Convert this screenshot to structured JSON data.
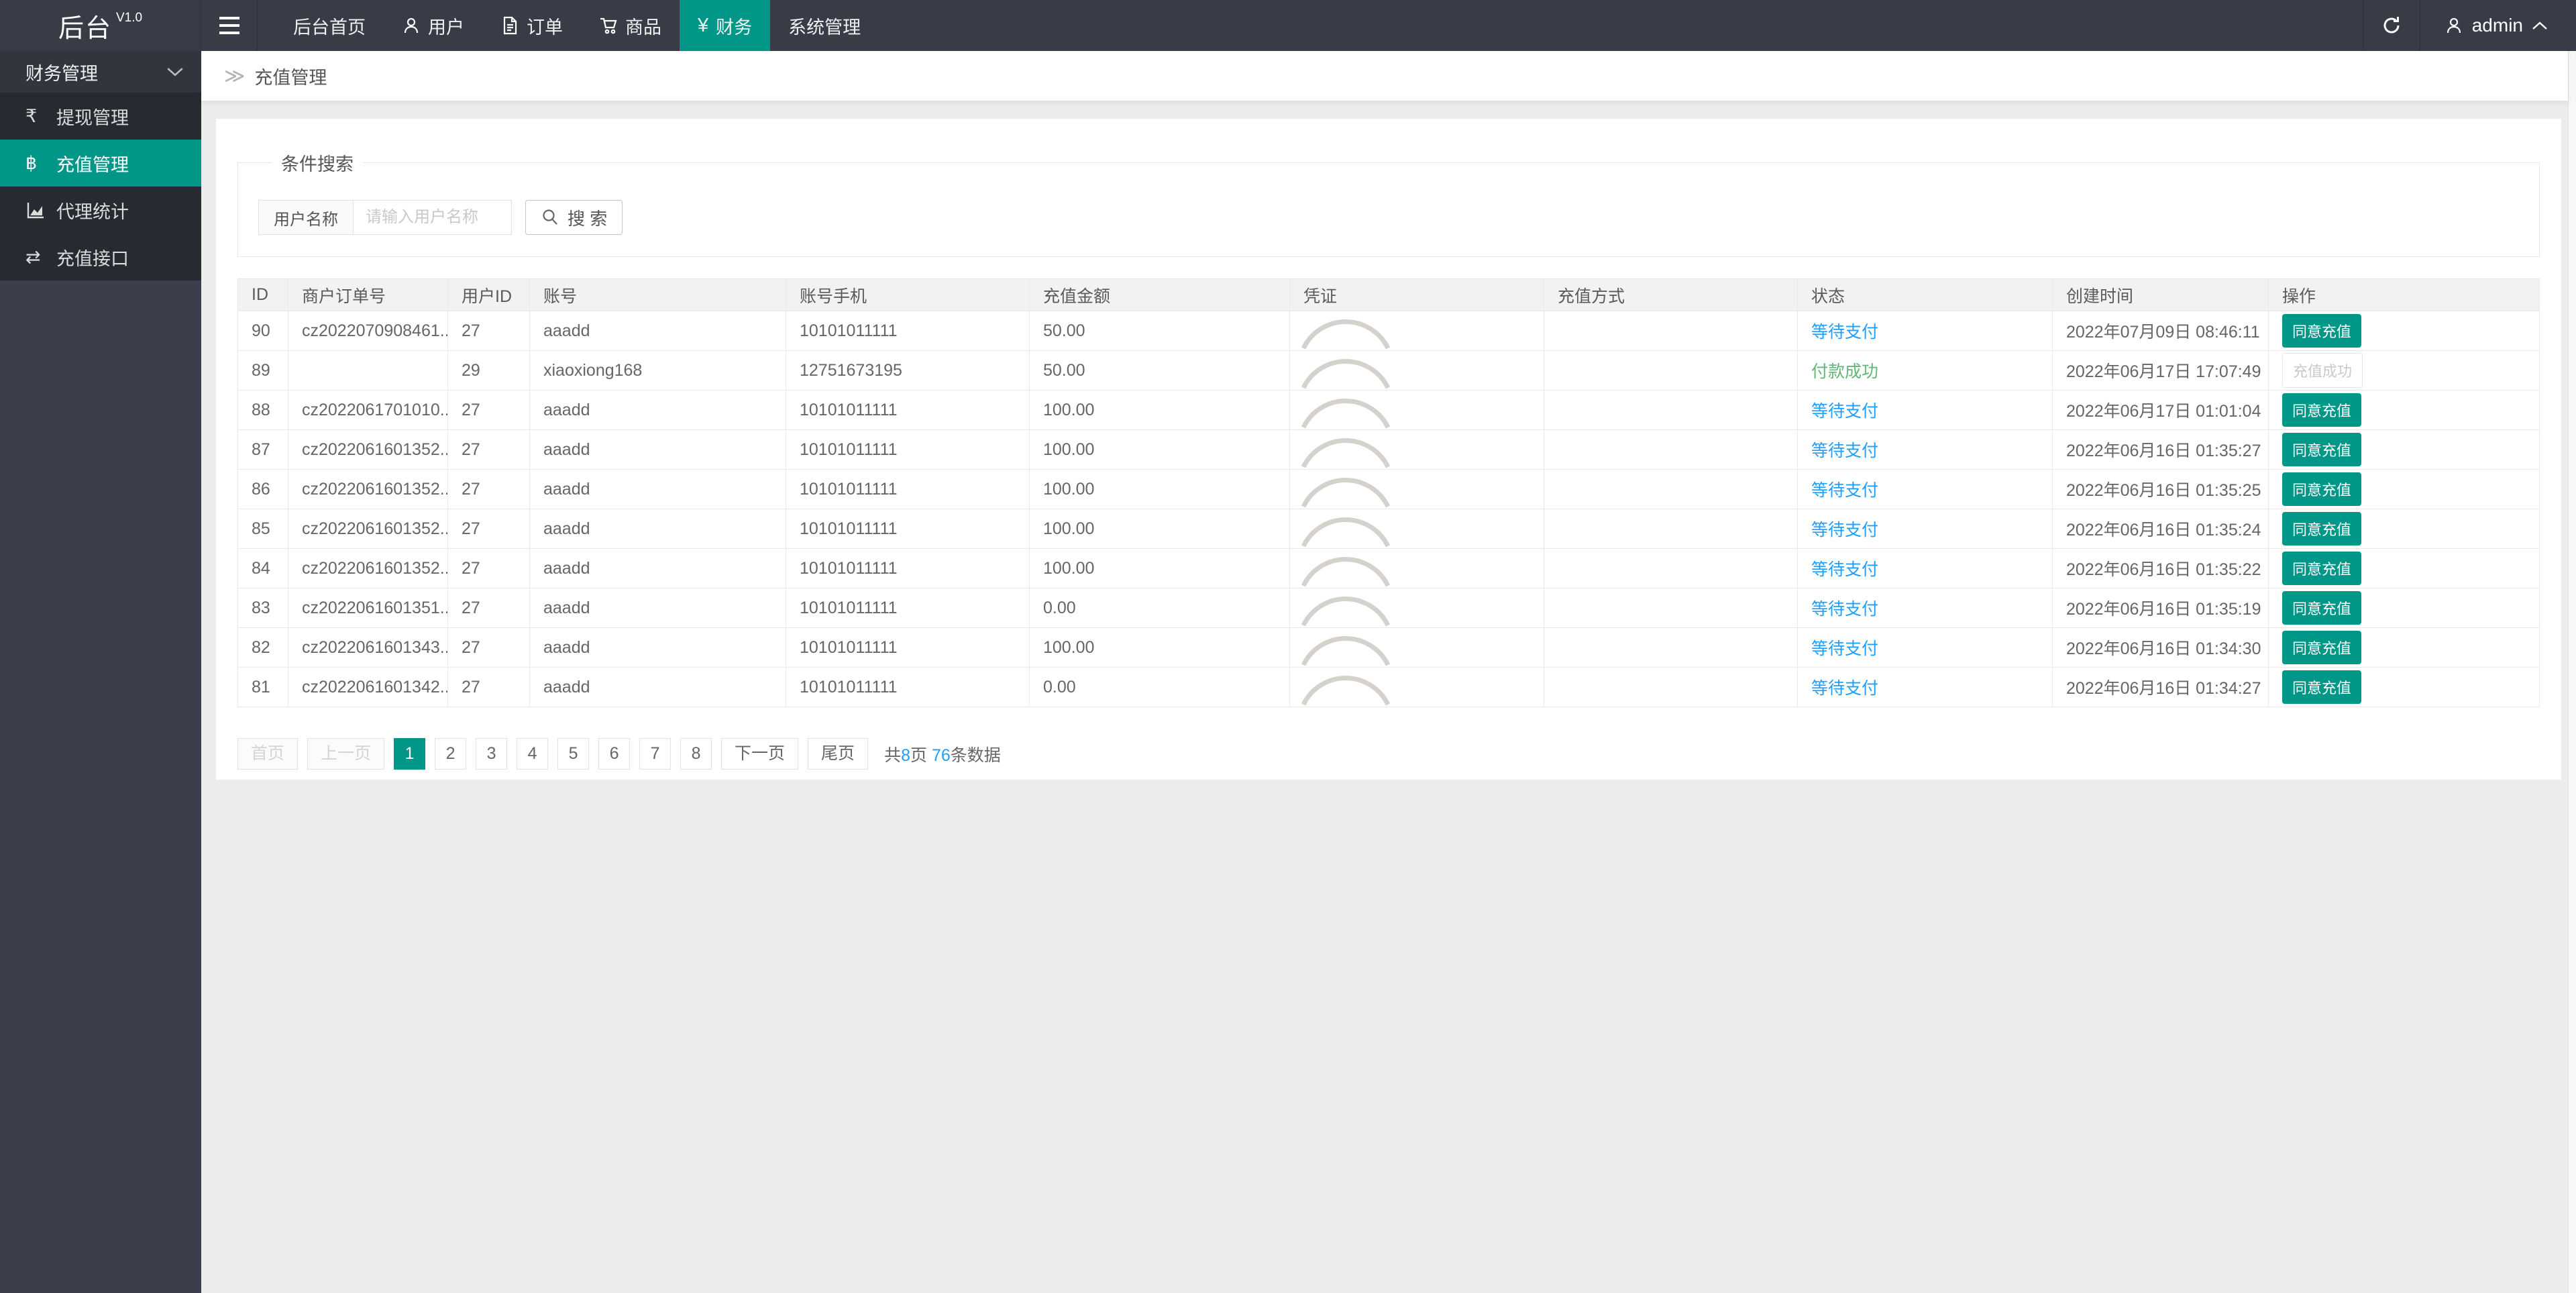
{
  "app": {
    "title": "后台",
    "version": "V1.0"
  },
  "topnav": {
    "items": [
      {
        "label": "后台首页",
        "icon": null
      },
      {
        "label": "用户",
        "icon": "user-icon"
      },
      {
        "label": "订单",
        "icon": "order-icon"
      },
      {
        "label": "商品",
        "icon": "cart-icon"
      },
      {
        "label": "财务",
        "icon": "yen-icon",
        "icon_glyph": "¥",
        "active": true
      },
      {
        "label": "系统管理",
        "icon": null
      }
    ],
    "right": {
      "user": "admin"
    }
  },
  "sidebar": {
    "group": {
      "label": "财务管理"
    },
    "items": [
      {
        "icon": "rupee-icon",
        "glyph": "₹",
        "label": "提现管理",
        "active": false
      },
      {
        "icon": "bitcoin-icon",
        "glyph": "฿",
        "label": "充值管理",
        "active": true
      },
      {
        "icon": "area-chart-icon",
        "glyph": null,
        "label": "代理统计",
        "active": false
      },
      {
        "icon": "exchange-icon",
        "glyph": "⇄",
        "label": "充值接口",
        "active": false
      }
    ]
  },
  "breadcrumb": {
    "sep": "≫",
    "title": "充值管理"
  },
  "search": {
    "legend": "条件搜索",
    "label": "用户名称",
    "placeholder": "请输入用户名称",
    "button": "搜 索"
  },
  "table": {
    "headers": [
      "ID",
      "商户订单号",
      "用户ID",
      "账号",
      "账号手机",
      "充值金额",
      "凭证",
      "充值方式",
      "状态",
      "创建时间",
      "操作"
    ],
    "rows": [
      {
        "id": "90",
        "order_no": "cz2022070908461...",
        "user_id": "27",
        "account": "aaadd",
        "phone": "10101011111",
        "amount": "50.00",
        "method": "",
        "status": "等待支付",
        "status_type": "status-wait",
        "created": "2022年07月09日 08:46:11",
        "action": "同意充值",
        "action_disabled": false
      },
      {
        "id": "89",
        "order_no": "",
        "user_id": "29",
        "account": "xiaoxiong168",
        "phone": "12751673195",
        "amount": "50.00",
        "method": "",
        "status": "付款成功",
        "status_type": "status-success",
        "created": "2022年06月17日 17:07:49",
        "action": "充值成功",
        "action_disabled": true
      },
      {
        "id": "88",
        "order_no": "cz2022061701010...",
        "user_id": "27",
        "account": "aaadd",
        "phone": "10101011111",
        "amount": "100.00",
        "method": "",
        "status": "等待支付",
        "status_type": "status-wait",
        "created": "2022年06月17日 01:01:04",
        "action": "同意充值",
        "action_disabled": false
      },
      {
        "id": "87",
        "order_no": "cz2022061601352...",
        "user_id": "27",
        "account": "aaadd",
        "phone": "10101011111",
        "amount": "100.00",
        "method": "",
        "status": "等待支付",
        "status_type": "status-wait",
        "created": "2022年06月16日 01:35:27",
        "action": "同意充值",
        "action_disabled": false
      },
      {
        "id": "86",
        "order_no": "cz2022061601352...",
        "user_id": "27",
        "account": "aaadd",
        "phone": "10101011111",
        "amount": "100.00",
        "method": "",
        "status": "等待支付",
        "status_type": "status-wait",
        "created": "2022年06月16日 01:35:25",
        "action": "同意充值",
        "action_disabled": false
      },
      {
        "id": "85",
        "order_no": "cz2022061601352...",
        "user_id": "27",
        "account": "aaadd",
        "phone": "10101011111",
        "amount": "100.00",
        "method": "",
        "status": "等待支付",
        "status_type": "status-wait",
        "created": "2022年06月16日 01:35:24",
        "action": "同意充值",
        "action_disabled": false
      },
      {
        "id": "84",
        "order_no": "cz2022061601352...",
        "user_id": "27",
        "account": "aaadd",
        "phone": "10101011111",
        "amount": "100.00",
        "method": "",
        "status": "等待支付",
        "status_type": "status-wait",
        "created": "2022年06月16日 01:35:22",
        "action": "同意充值",
        "action_disabled": false
      },
      {
        "id": "83",
        "order_no": "cz2022061601351...",
        "user_id": "27",
        "account": "aaadd",
        "phone": "10101011111",
        "amount": "0.00",
        "method": "",
        "status": "等待支付",
        "status_type": "status-wait",
        "created": "2022年06月16日 01:35:19",
        "action": "同意充值",
        "action_disabled": false
      },
      {
        "id": "82",
        "order_no": "cz2022061601343...",
        "user_id": "27",
        "account": "aaadd",
        "phone": "10101011111",
        "amount": "100.00",
        "method": "",
        "status": "等待支付",
        "status_type": "status-wait",
        "created": "2022年06月16日 01:34:30",
        "action": "同意充值",
        "action_disabled": false
      },
      {
        "id": "81",
        "order_no": "cz2022061601342...",
        "user_id": "27",
        "account": "aaadd",
        "phone": "10101011111",
        "amount": "0.00",
        "method": "",
        "status": "等待支付",
        "status_type": "status-wait",
        "created": "2022年06月16日 01:34:27",
        "action": "同意充值",
        "action_disabled": false
      }
    ]
  },
  "pagination": {
    "first": "首页",
    "prev": "上一页",
    "next": "下一页",
    "last": "尾页",
    "pages": [
      "1",
      "2",
      "3",
      "4",
      "5",
      "6",
      "7",
      "8"
    ],
    "active": "1",
    "summary": {
      "t1": "共",
      "pages": "8",
      "t2": "页 ",
      "count": "76",
      "t3": "条数据"
    }
  },
  "colors": {
    "accent": "#009688",
    "link_blue": "#1E9FFF",
    "success_green": "#5FB878"
  }
}
